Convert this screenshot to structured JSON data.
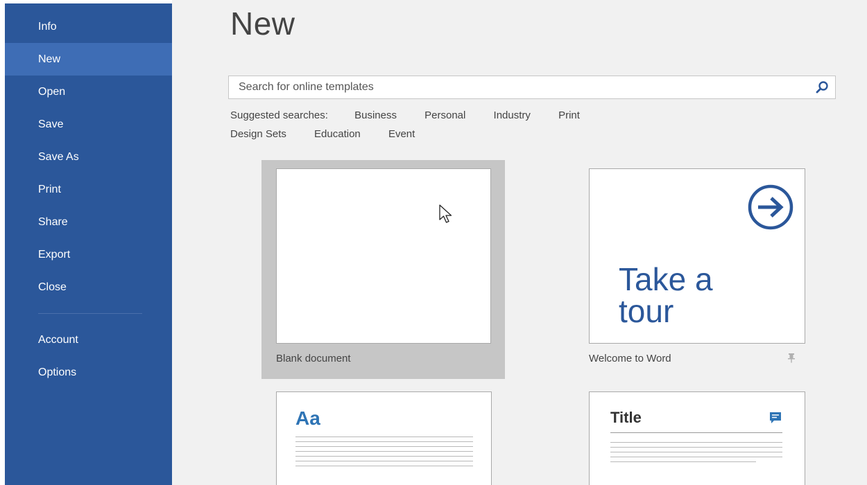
{
  "sidebar": {
    "items": [
      {
        "label": "Info"
      },
      {
        "label": "New"
      },
      {
        "label": "Open"
      },
      {
        "label": "Save"
      },
      {
        "label": "Save As"
      },
      {
        "label": "Print"
      },
      {
        "label": "Share"
      },
      {
        "label": "Export"
      },
      {
        "label": "Close"
      },
      {
        "label": "Account"
      },
      {
        "label": "Options"
      }
    ],
    "selected": "New",
    "bg_color": "#2b579a",
    "selected_color": "#3e6db5"
  },
  "main": {
    "title": "New",
    "search": {
      "placeholder": "Search for online templates",
      "value": "",
      "icon": "search-icon"
    },
    "suggested": {
      "label": "Suggested searches:",
      "terms": [
        "Business",
        "Personal",
        "Industry",
        "Print",
        "Design Sets",
        "Education",
        "Event"
      ]
    },
    "templates": [
      {
        "caption": "Blank document",
        "selected": true
      },
      {
        "caption": "Welcome to Word",
        "preview_lines": [
          "Take a",
          "tour"
        ],
        "icon": "arrow-right-circle-icon",
        "pin_icon": "pin-icon"
      },
      {
        "caption": "",
        "preview_heading": "Aa"
      },
      {
        "caption": "",
        "preview_heading": "Title",
        "icon": "comment-icon"
      }
    ]
  },
  "colors": {
    "accent": "#2b579a",
    "aa_blue": "#2e74b5",
    "panel_bg": "#f1f1f1"
  }
}
